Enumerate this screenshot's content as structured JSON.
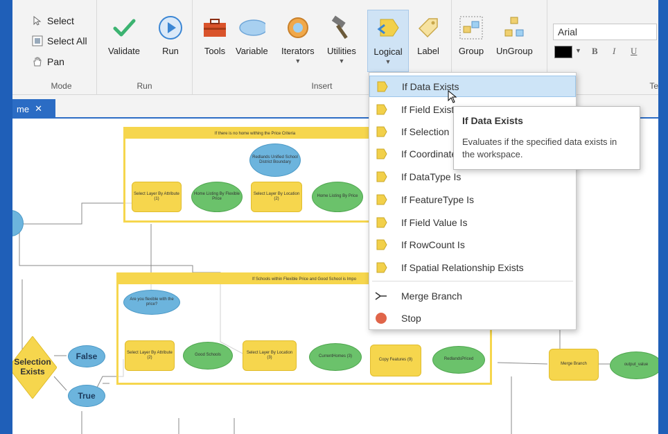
{
  "ribbon": {
    "mode": {
      "select": "Select",
      "select_all": "Select All",
      "pan": "Pan",
      "label": "Mode"
    },
    "run": {
      "validate": "Validate",
      "run": "Run",
      "label": "Run"
    },
    "insert": {
      "tools": "Tools",
      "variable": "Variable",
      "iterators": "Iterators",
      "utilities": "Utilities",
      "logical": "Logical",
      "label_btn": "Label",
      "label": "Insert"
    },
    "group": {
      "group": "Group",
      "ungroup": "UnGroup"
    },
    "text": {
      "font": "Arial",
      "bold": "B",
      "italic": "I",
      "underline": "U",
      "label": "Tex"
    }
  },
  "doc_tab": {
    "label": "me",
    "close": "✕"
  },
  "menu": {
    "items": [
      "If Data Exists",
      "If Field Exists",
      "If Selection",
      "If Coordinate",
      "If DataType Is",
      "If FeatureType Is",
      "If Field Value Is",
      "If RowCount Is",
      "If Spatial Relationship Exists"
    ],
    "merge_branch": "Merge Branch",
    "stop": "Stop"
  },
  "tooltip": {
    "title": "If Data Exists",
    "description": "Evaluates if the specified data exists in the workspace."
  },
  "diagram": {
    "group1_title": "If there is no home withing the Price Criteria",
    "group2_title": "If Schools within Flexible Price and Good School is Impo",
    "nodes": {
      "select_attr_1": "Select Layer By Attribute (1)",
      "home_listing_flex": "Home Listing By Flexible Price",
      "select_loc_2": "Select Layer By Location (2)",
      "home_listing_price": "Home Listing By Price",
      "school_district": "Redlands Unified School District Boundary",
      "select_attr_2": "Select Layer By Attribute (2)",
      "good_schools": "Good Schools",
      "select_loc_3": "Select Layer By Location (3)",
      "current_homes": "CurrentHomes (3)",
      "copy_features": "Copy Features (9)",
      "redlands_priced": "RedlandsPriced",
      "flexible_q": "Are you flexible with the price?",
      "selection_exists": "Selection Exists",
      "false": "False",
      "true": "True",
      "merge_branch": "Merge Branch",
      "output_value": "output_value"
    }
  },
  "colors": {
    "accent": "#2b6cc4",
    "node_rect": "#f6d64d",
    "node_oval": "#6bc26b",
    "node_blue": "#6cb4dd"
  }
}
